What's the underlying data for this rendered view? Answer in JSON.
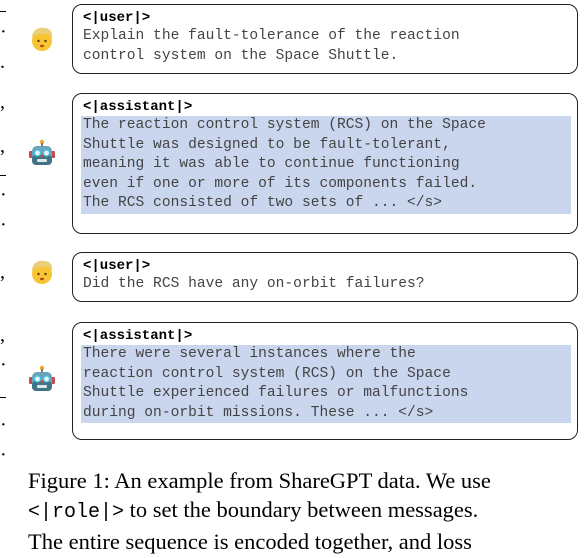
{
  "conversation": [
    {
      "role_tag": "<|user|>",
      "speaker": "user",
      "lines": [
        "Explain the fault-tolerance of the reaction",
        "control system on the Space Shuttle."
      ]
    },
    {
      "role_tag": "<|assistant|>",
      "speaker": "assistant",
      "lines": [
        "The reaction control system (RCS) on the Space",
        "Shuttle was designed to be fault-tolerant,",
        "meaning it was able to continue functioning",
        "even if one or more of its components failed.",
        "The RCS consisted of two sets of ... </s>"
      ]
    },
    {
      "role_tag": "<|user|>",
      "speaker": "user",
      "lines": [
        "Did the RCS have any on-orbit failures?"
      ]
    },
    {
      "role_tag": "<|assistant|>",
      "speaker": "assistant",
      "lines": [
        "There were several instances where the",
        "reaction control system (RCS) on the Space",
        "Shuttle experienced failures or malfunctions",
        "during on-orbit missions. These ... </s>"
      ]
    }
  ],
  "caption": {
    "line1": "Figure 1: An example from ShareGPT data. We use",
    "line2_code": "<|role|>",
    "line2_rest": " to set the boundary between messages.",
    "line3": "The entire sequence is encoded together, and loss"
  },
  "colors": {
    "assistant_highlight": "#c9d6ee",
    "message_text": "#444444",
    "border": "#222222"
  }
}
